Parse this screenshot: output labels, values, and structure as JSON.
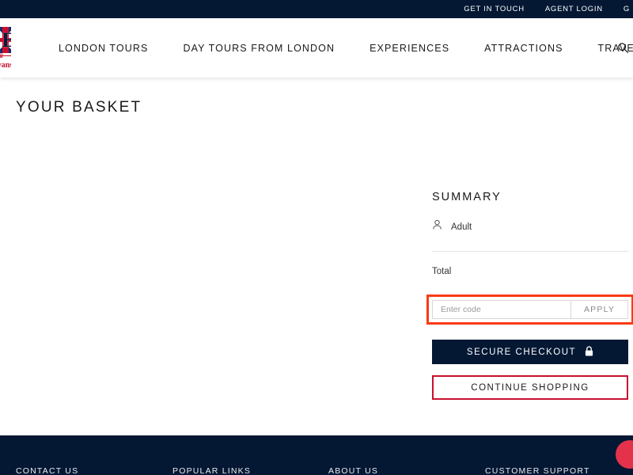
{
  "topbar": {
    "links": [
      {
        "label": "GET IN TOUCH",
        "name": "get-in-touch"
      },
      {
        "label": "AGENT LOGIN",
        "name": "agent-login"
      },
      {
        "label": "G",
        "name": "third-link-truncated"
      }
    ]
  },
  "logo": {
    "letters": "EE",
    "name": "n Evans",
    "crown": "♛"
  },
  "nav": {
    "items": [
      {
        "label": "LONDON TOURS",
        "name": "london-tours"
      },
      {
        "label": "DAY TOURS FROM LONDON",
        "name": "day-tours-from-london"
      },
      {
        "label": "EXPERIENCES",
        "name": "experiences"
      },
      {
        "label": "ATTRACTIONS",
        "name": "attractions"
      },
      {
        "label": "TRAVEL GUIDE",
        "name": "travel-guide"
      }
    ],
    "search_icon": "search-icon"
  },
  "page": {
    "title": "YOUR BASKET"
  },
  "summary": {
    "title": "SUMMARY",
    "person_icon": "person-icon",
    "line_item_label": "Adult",
    "total_label": "Total"
  },
  "promo": {
    "placeholder": "Enter code",
    "apply_label": "APPLY",
    "value": "",
    "highlight_color": "#f93a14"
  },
  "actions": {
    "checkout_label": "SECURE CHECKOUT",
    "lock_icon": "lock-icon",
    "continue_label": "CONTINUE SHOPPING",
    "checkout_bg": "#041834",
    "continue_border": "#c8102e"
  },
  "footer": {
    "columns": [
      {
        "heading": "CONTACT US",
        "name": "contact-us"
      },
      {
        "heading": "POPULAR LINKS",
        "name": "popular-links"
      },
      {
        "heading": "ABOUT US",
        "name": "about-us"
      },
      {
        "heading": "CUSTOMER SUPPORT",
        "name": "customer-support"
      }
    ],
    "chat_color": "#e5324b"
  }
}
